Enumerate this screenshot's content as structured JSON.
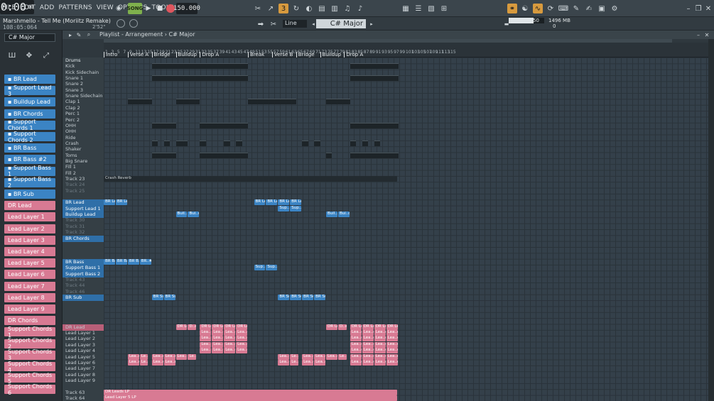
{
  "menu": [
    "FILE",
    "EDIT",
    "ADD",
    "PATTERNS",
    "VIEW",
    "OPTIONS",
    "TOOLS",
    "HELP"
  ],
  "transport": {
    "mode_label": "SONG",
    "tempo": "150.000",
    "time": "0:00",
    "time_sub": "00"
  },
  "song": {
    "title": "Marshmello - Tell Me (Moriitz Remake)",
    "time": "108:05:064",
    "length": "2'52\""
  },
  "toolbar": {
    "snap": "Line",
    "scale": "C# Major",
    "cpu": "50",
    "memory": "1496 MB",
    "polyphony": "0"
  },
  "playlist": {
    "title": "Playlist - Arrangement",
    "breadcrumb": "C# Major"
  },
  "channel_list": {
    "selected": "C# Major",
    "items": [
      {
        "label": "BR Lead",
        "color": "blue"
      },
      {
        "label": "Support Lead 3",
        "color": "blue"
      },
      {
        "label": "Buildup Lead",
        "color": "blue"
      },
      {
        "label": "BR Chords",
        "color": "blue"
      },
      {
        "label": "Support Chords 1",
        "color": "blue"
      },
      {
        "label": "Support Chords 2",
        "color": "blue"
      },
      {
        "label": "BR Bass",
        "color": "blue"
      },
      {
        "label": "BR Bass #2",
        "color": "blue"
      },
      {
        "label": "Support Bass 1",
        "color": "blue"
      },
      {
        "label": "Support Bass 2",
        "color": "blue"
      },
      {
        "label": "BR Sub",
        "color": "blue"
      },
      {
        "label": "DR Lead",
        "color": "pink"
      },
      {
        "label": "Lead Layer 1",
        "color": "pink"
      },
      {
        "label": "Lead Layer 2",
        "color": "pink"
      },
      {
        "label": "Lead Layer 3",
        "color": "pink"
      },
      {
        "label": "Lead Layer 4",
        "color": "pink"
      },
      {
        "label": "Lead Layer 5",
        "color": "pink"
      },
      {
        "label": "Lead Layer 6",
        "color": "pink"
      },
      {
        "label": "Lead Layer 7",
        "color": "pink"
      },
      {
        "label": "Lead Layer 8",
        "color": "pink"
      },
      {
        "label": "Lead Layer 9",
        "color": "pink"
      },
      {
        "label": "DR Chords",
        "color": "pink"
      },
      {
        "label": "Support Chords 1",
        "color": "pink"
      },
      {
        "label": "Support Chords 2",
        "color": "pink"
      },
      {
        "label": "Support Chords 3",
        "color": "pink"
      },
      {
        "label": "Support Chords 4",
        "color": "pink"
      },
      {
        "label": "Support Chords 5",
        "color": "pink"
      },
      {
        "label": "Support Chords 6",
        "color": "pink"
      }
    ]
  },
  "tracks": [
    {
      "label": "Drums",
      "kind": "hdr"
    },
    {
      "label": "Kick"
    },
    {
      "label": "Kick Sidechain"
    },
    {
      "label": "Snare 1"
    },
    {
      "label": "Snare 2"
    },
    {
      "label": "Snare 3"
    },
    {
      "label": "Snare Sidechain"
    },
    {
      "label": "Clap 1"
    },
    {
      "label": "Clap 2"
    },
    {
      "label": "Perc 1"
    },
    {
      "label": "Perc 2"
    },
    {
      "label": "OHH"
    },
    {
      "label": "OHH"
    },
    {
      "label": "Ride"
    },
    {
      "label": "Crash"
    },
    {
      "label": "Shaker"
    },
    {
      "label": "Toms"
    },
    {
      "label": "Big Snare"
    },
    {
      "label": "Fill 1"
    },
    {
      "label": "Fill 2"
    },
    {
      "label": "Track 23"
    },
    {
      "label": "Track 24",
      "kind": "dim"
    },
    {
      "label": "Track 25",
      "kind": "dim"
    },
    {
      "label": "",
      "kind": "gap"
    },
    {
      "label": "BR Lead",
      "kind": "blue"
    },
    {
      "label": "Support Lead 1",
      "kind": "blue"
    },
    {
      "label": "Buildup Lead",
      "kind": "blue"
    },
    {
      "label": "Track 30",
      "kind": "dim"
    },
    {
      "label": "Track 31",
      "kind": "dim"
    },
    {
      "label": "Track 32",
      "kind": "dim"
    },
    {
      "label": "BR Chords",
      "kind": "blue"
    },
    {
      "label": "",
      "kind": "gap"
    },
    {
      "label": "",
      "kind": "gap"
    },
    {
      "label": "",
      "kind": "gap"
    },
    {
      "label": "BR Bass",
      "kind": "blue"
    },
    {
      "label": "Support Bass 1",
      "kind": "blue"
    },
    {
      "label": "Support Bass 2",
      "kind": "blue"
    },
    {
      "label": "Track 43",
      "kind": "dim"
    },
    {
      "label": "Track 44",
      "kind": "dim"
    },
    {
      "label": "Track 46",
      "kind": "dim"
    },
    {
      "label": "BR Sub",
      "kind": "blue"
    },
    {
      "label": "",
      "kind": "gap"
    },
    {
      "label": "",
      "kind": "gap"
    },
    {
      "label": "",
      "kind": "gap"
    },
    {
      "label": "",
      "kind": "gap"
    },
    {
      "label": "DR Lead",
      "kind": "pink"
    },
    {
      "label": "Lead Layer 1"
    },
    {
      "label": "Lead Layer 2"
    },
    {
      "label": "Lead Layer 3"
    },
    {
      "label": "Lead Layer 4"
    },
    {
      "label": "Lead Layer 5"
    },
    {
      "label": "Lead Layer 6"
    },
    {
      "label": "Lead Layer 7"
    },
    {
      "label": "Lead Layer 8"
    },
    {
      "label": "Lead Layer 9"
    },
    {
      "label": "",
      "kind": "gap"
    },
    {
      "label": "Track 63"
    },
    {
      "label": "Track 64"
    },
    {
      "label": "Track 65"
    },
    {
      "label": "Track 66"
    }
  ],
  "bars": [
    "1",
    "3",
    "5",
    "7",
    "9",
    "11",
    "13",
    "15",
    "17",
    "19",
    "21",
    "23",
    "25",
    "27",
    "29",
    "31",
    "33",
    "35",
    "37",
    "39",
    "41",
    "43",
    "45",
    "47",
    "49",
    "51",
    "53",
    "55",
    "57",
    "59",
    "61",
    "63",
    "65",
    "67",
    "69",
    "71",
    "73",
    "75",
    "77",
    "79",
    "81",
    "83",
    "85",
    "87",
    "89",
    "91",
    "93",
    "95",
    "97",
    "99",
    "101",
    "103",
    "105",
    "107",
    "109",
    "111",
    "113",
    "115"
  ],
  "markers": [
    {
      "label": "Intro",
      "bar": 1
    },
    {
      "label": "Verse A",
      "bar": 9
    },
    {
      "label": "Bridge",
      "bar": 17
    },
    {
      "label": "Buildup",
      "bar": 25
    },
    {
      "label": "Drop A",
      "bar": 33
    },
    {
      "label": "Break",
      "bar": 49
    },
    {
      "label": "Verse B",
      "bar": 57
    },
    {
      "label": "Bridge",
      "bar": 65
    },
    {
      "label": "Buildup",
      "bar": 73
    },
    {
      "label": "Drop A",
      "bar": 81
    }
  ],
  "clips": [
    {
      "track": 24,
      "bar": 1,
      "len": 4,
      "label": "BR Lead",
      "color": "blue"
    },
    {
      "track": 24,
      "bar": 5,
      "len": 4,
      "label": "BR Lead",
      "color": "blue"
    },
    {
      "track": 24,
      "bar": 51,
      "len": 4,
      "label": "BR Lead",
      "color": "blue"
    },
    {
      "track": 24,
      "bar": 55,
      "len": 4,
      "label": "BR Lead",
      "color": "blue"
    },
    {
      "track": 24,
      "bar": 59,
      "len": 4,
      "label": "BR Lead",
      "color": "blue"
    },
    {
      "track": 24,
      "bar": 63,
      "len": 4,
      "label": "BR Lead",
      "color": "blue"
    },
    {
      "track": 25,
      "bar": 59,
      "len": 4,
      "label": "Sup..d 3",
      "color": "blue"
    },
    {
      "track": 25,
      "bar": 63,
      "len": 4,
      "label": "Sup..d 3",
      "color": "blue"
    },
    {
      "track": 26,
      "bar": 25,
      "len": 4,
      "label": "Buil..ad",
      "color": "blue"
    },
    {
      "track": 26,
      "bar": 29,
      "len": 4,
      "label": "Bui..d",
      "color": "blue"
    },
    {
      "track": 26,
      "bar": 75,
      "len": 4,
      "label": "Buil..ad",
      "color": "blue"
    },
    {
      "track": 26,
      "bar": 79,
      "len": 4,
      "label": "Bui..d",
      "color": "blue"
    },
    {
      "track": 34,
      "bar": 1,
      "len": 4,
      "label": "BR Bass",
      "color": "blue"
    },
    {
      "track": 34,
      "bar": 5,
      "len": 4,
      "label": "BR Bass",
      "color": "blue"
    },
    {
      "track": 34,
      "bar": 9,
      "len": 4,
      "label": "BR B..#2",
      "color": "blue"
    },
    {
      "track": 34,
      "bar": 13,
      "len": 4,
      "label": "BR..#2",
      "color": "blue"
    },
    {
      "track": 35,
      "bar": 51,
      "len": 4,
      "label": "Sup..s 1",
      "color": "blue"
    },
    {
      "track": 35,
      "bar": 55,
      "len": 4,
      "label": "Sup..s 1",
      "color": "blue"
    },
    {
      "track": 40,
      "bar": 17,
      "len": 4,
      "label": "BR Sub",
      "color": "blue"
    },
    {
      "track": 40,
      "bar": 21,
      "len": 4,
      "label": "BR Sub",
      "color": "blue"
    },
    {
      "track": 40,
      "bar": 59,
      "len": 4,
      "label": "BR Sub",
      "color": "blue"
    },
    {
      "track": 40,
      "bar": 63,
      "len": 4,
      "label": "BR Sub",
      "color": "blue"
    },
    {
      "track": 40,
      "bar": 67,
      "len": 4,
      "label": "BR Sub",
      "color": "blue"
    },
    {
      "track": 40,
      "bar": 71,
      "len": 4,
      "label": "BR Sub",
      "color": "blue"
    },
    {
      "track": 45,
      "bar": 25,
      "len": 4,
      "label": "DR Lead",
      "color": "pink"
    },
    {
      "track": 45,
      "bar": 29,
      "len": 3,
      "label": "D..ad",
      "color": "pink"
    },
    {
      "track": 45,
      "bar": 33,
      "len": 4,
      "label": "DR Lead",
      "color": "pink"
    },
    {
      "track": 45,
      "bar": 37,
      "len": 4,
      "label": "DR Lead",
      "color": "pink"
    },
    {
      "track": 45,
      "bar": 41,
      "len": 4,
      "label": "DR Lead",
      "color": "pink"
    },
    {
      "track": 45,
      "bar": 45,
      "len": 4,
      "label": "DR Lead",
      "color": "pink"
    },
    {
      "track": 45,
      "bar": 75,
      "len": 4,
      "label": "DR Lead",
      "color": "pink"
    },
    {
      "track": 45,
      "bar": 79,
      "len": 3,
      "label": "D..ad",
      "color": "pink"
    },
    {
      "track": 45,
      "bar": 83,
      "len": 4,
      "label": "DR Lead",
      "color": "pink"
    },
    {
      "track": 45,
      "bar": 87,
      "len": 4,
      "label": "DR Lead",
      "color": "pink"
    },
    {
      "track": 45,
      "bar": 91,
      "len": 4,
      "label": "DR Lead",
      "color": "pink"
    },
    {
      "track": 45,
      "bar": 95,
      "len": 4,
      "label": "DR Lead",
      "color": "pink"
    },
    {
      "track": 46,
      "bar": 33,
      "len": 4,
      "label": "Lea..er 1",
      "color": "pink"
    },
    {
      "track": 46,
      "bar": 37,
      "len": 4,
      "label": "Lea..er 1",
      "color": "pink"
    },
    {
      "track": 46,
      "bar": 41,
      "len": 4,
      "label": "Lea..er 1",
      "color": "pink"
    },
    {
      "track": 46,
      "bar": 45,
      "len": 4,
      "label": "Lea..er 1",
      "color": "pink"
    },
    {
      "track": 46,
      "bar": 83,
      "len": 4,
      "label": "Lea..er 1",
      "color": "pink"
    },
    {
      "track": 46,
      "bar": 87,
      "len": 4,
      "label": "Lea..er 1",
      "color": "pink"
    },
    {
      "track": 46,
      "bar": 91,
      "len": 4,
      "label": "Lea..er 1",
      "color": "pink"
    },
    {
      "track": 46,
      "bar": 95,
      "len": 4,
      "label": "Lea..er 1",
      "color": "pink"
    },
    {
      "track": 47,
      "bar": 33,
      "len": 4,
      "label": "Lea..er 2",
      "color": "pink"
    },
    {
      "track": 47,
      "bar": 37,
      "len": 4,
      "label": "Lea..er 2",
      "color": "pink"
    },
    {
      "track": 47,
      "bar": 41,
      "len": 4,
      "label": "Lea..er 2",
      "color": "pink"
    },
    {
      "track": 47,
      "bar": 45,
      "len": 4,
      "label": "Lea..er 2",
      "color": "pink"
    },
    {
      "track": 47,
      "bar": 83,
      "len": 4,
      "label": "Lea..er 2",
      "color": "pink"
    },
    {
      "track": 47,
      "bar": 87,
      "len": 4,
      "label": "Lea..er 2",
      "color": "pink"
    },
    {
      "track": 47,
      "bar": 91,
      "len": 4,
      "label": "Lea..er 2",
      "color": "pink"
    },
    {
      "track": 47,
      "bar": 95,
      "len": 4,
      "label": "Lea..er 2",
      "color": "pink"
    },
    {
      "track": 48,
      "bar": 33,
      "len": 4,
      "label": "Lea..er 3",
      "color": "pink"
    },
    {
      "track": 48,
      "bar": 37,
      "len": 4,
      "label": "Lea..er 3",
      "color": "pink"
    },
    {
      "track": 48,
      "bar": 41,
      "len": 4,
      "label": "Lea..er 3",
      "color": "pink"
    },
    {
      "track": 48,
      "bar": 45,
      "len": 4,
      "label": "Lea..er 3",
      "color": "pink"
    },
    {
      "track": 48,
      "bar": 83,
      "len": 4,
      "label": "Lea..er 3",
      "color": "pink"
    },
    {
      "track": 48,
      "bar": 87,
      "len": 4,
      "label": "Lea..er 3",
      "color": "pink"
    },
    {
      "track": 48,
      "bar": 91,
      "len": 4,
      "label": "Lea..er 3",
      "color": "pink"
    },
    {
      "track": 48,
      "bar": 95,
      "len": 4,
      "label": "Lea..er 3",
      "color": "pink"
    },
    {
      "track": 49,
      "bar": 33,
      "len": 4,
      "label": "Lea..er 4",
      "color": "pink"
    },
    {
      "track": 49,
      "bar": 37,
      "len": 4,
      "label": "Lea..er 4",
      "color": "pink"
    },
    {
      "track": 49,
      "bar": 41,
      "len": 4,
      "label": "Lea..er 4",
      "color": "pink"
    },
    {
      "track": 49,
      "bar": 45,
      "len": 4,
      "label": "Lea..er 4",
      "color": "pink"
    },
    {
      "track": 49,
      "bar": 83,
      "len": 4,
      "label": "Lea..er 4",
      "color": "pink"
    },
    {
      "track": 49,
      "bar": 87,
      "len": 4,
      "label": "Lea..er 4",
      "color": "pink"
    },
    {
      "track": 49,
      "bar": 91,
      "len": 4,
      "label": "Lea..er 4",
      "color": "pink"
    },
    {
      "track": 49,
      "bar": 95,
      "len": 4,
      "label": "Lea..er 4",
      "color": "pink"
    },
    {
      "track": 50,
      "bar": 9,
      "len": 4,
      "label": "Lea..er 5",
      "color": "pink"
    },
    {
      "track": 50,
      "bar": 13,
      "len": 3,
      "label": "Le..r 5",
      "color": "pink"
    },
    {
      "track": 50,
      "bar": 17,
      "len": 4,
      "label": "Lea..er 5",
      "color": "pink"
    },
    {
      "track": 50,
      "bar": 21,
      "len": 4,
      "label": "Lea..er 5",
      "color": "pink"
    },
    {
      "track": 50,
      "bar": 25,
      "len": 4,
      "label": "Lea..er 5",
      "color": "pink"
    },
    {
      "track": 50,
      "bar": 29,
      "len": 3,
      "label": "Le..r 5",
      "color": "pink"
    },
    {
      "track": 50,
      "bar": 59,
      "len": 4,
      "label": "Lea..er 5",
      "color": "pink"
    },
    {
      "track": 50,
      "bar": 63,
      "len": 3,
      "label": "Le..r 5",
      "color": "pink"
    },
    {
      "track": 50,
      "bar": 67,
      "len": 4,
      "label": "Lea..er 5",
      "color": "pink"
    },
    {
      "track": 50,
      "bar": 71,
      "len": 4,
      "label": "Lea..er 5",
      "color": "pink"
    },
    {
      "track": 50,
      "bar": 75,
      "len": 4,
      "label": "Lea..er 5",
      "color": "pink"
    },
    {
      "track": 50,
      "bar": 79,
      "len": 3,
      "label": "Le..r 5",
      "color": "pink"
    },
    {
      "track": 50,
      "bar": 83,
      "len": 4,
      "label": "Lea..er 5",
      "color": "pink"
    },
    {
      "track": 50,
      "bar": 87,
      "len": 4,
      "label": "Lea..er 5",
      "color": "pink"
    },
    {
      "track": 50,
      "bar": 91,
      "len": 4,
      "label": "Lea..er 5",
      "color": "pink"
    },
    {
      "track": 50,
      "bar": 95,
      "len": 4,
      "label": "Lea..er 5",
      "color": "pink"
    },
    {
      "track": 51,
      "bar": 9,
      "len": 4,
      "label": "Lea..er 6",
      "color": "pink"
    },
    {
      "track": 51,
      "bar": 13,
      "len": 3,
      "label": "Le..r 6",
      "color": "pink"
    },
    {
      "track": 51,
      "bar": 17,
      "len": 4,
      "label": "Lea..er 6",
      "color": "pink"
    },
    {
      "track": 51,
      "bar": 21,
      "len": 4,
      "label": "Lea..er 6",
      "color": "pink"
    },
    {
      "track": 51,
      "bar": 59,
      "len": 4,
      "label": "Lea..er 6",
      "color": "pink"
    },
    {
      "track": 51,
      "bar": 63,
      "len": 3,
      "label": "Le..r 6",
      "color": "pink"
    },
    {
      "track": 51,
      "bar": 67,
      "len": 4,
      "label": "Lea..er 6",
      "color": "pink"
    },
    {
      "track": 51,
      "bar": 71,
      "len": 4,
      "label": "Lea..er 6",
      "color": "pink"
    },
    {
      "track": 51,
      "bar": 83,
      "len": 4,
      "label": "Lea..er 6",
      "color": "pink"
    },
    {
      "track": 51,
      "bar": 87,
      "len": 4,
      "label": "Lea..er 6",
      "color": "pink"
    },
    {
      "track": 51,
      "bar": 91,
      "len": 4,
      "label": "Lea..er 6",
      "color": "pink"
    },
    {
      "track": 51,
      "bar": 95,
      "len": 4,
      "label": "Lea..er 6",
      "color": "pink"
    }
  ],
  "long_clips": [
    {
      "track": 20,
      "label": "Crash Reverb",
      "color": "reverb"
    },
    {
      "track": 56,
      "label": "DR Leads LP",
      "color": "pink"
    },
    {
      "track": 57,
      "label": "Lead Layer 5 LP",
      "color": "pink"
    },
    {
      "track": 58,
      "label": "Lead Layer 6 LP",
      "color": "pink"
    },
    {
      "track": 59,
      "label": "DR Lead Serum LP",
      "color": "pink"
    }
  ]
}
